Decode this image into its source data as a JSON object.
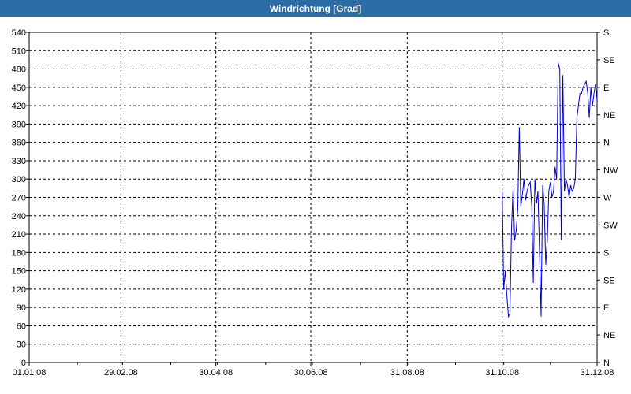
{
  "window": {
    "title": "Windrichtung [Grad]"
  },
  "chart_data": {
    "type": "line",
    "title": "Windrichtung [Grad]",
    "x_tick_labels": [
      "01.01.08",
      "29.02.08",
      "30.04.08",
      "30.06.08",
      "31.08.08",
      "31.10.08",
      "31.12.08"
    ],
    "y_ticks": [
      0,
      30,
      60,
      90,
      120,
      150,
      180,
      210,
      240,
      270,
      300,
      330,
      360,
      390,
      420,
      450,
      480,
      510,
      540
    ],
    "ylim": [
      0,
      540
    ],
    "right_axis_labels": [
      "N",
      "NE",
      "E",
      "SE",
      "S",
      "SW",
      "W",
      "NW",
      "N",
      "NE",
      "E",
      "SE",
      "S"
    ],
    "right_axis_step": 45,
    "x_start": "01.01.08",
    "x_end": "31.12.08",
    "grid": true,
    "line_color": "#0000cc",
    "series": [
      {
        "x": [
          "31.10.08",
          "01.11.08",
          "02.11.08",
          "03.11.08",
          "04.11.08",
          "05.11.08",
          "06.11.08",
          "07.11.08",
          "08.11.08",
          "09.11.08",
          "10.11.08",
          "11.11.08",
          "12.11.08",
          "13.11.08",
          "14.11.08",
          "15.11.08",
          "16.11.08",
          "17.11.08",
          "18.11.08",
          "19.11.08",
          "20.11.08",
          "21.11.08",
          "22.11.08",
          "23.11.08",
          "24.11.08",
          "25.11.08",
          "26.11.08",
          "27.11.08",
          "28.11.08",
          "29.11.08",
          "30.11.08",
          "01.12.08",
          "02.12.08",
          "03.12.08",
          "04.12.08",
          "05.12.08",
          "06.12.08",
          "07.12.08",
          "08.12.08",
          "09.12.08",
          "10.12.08",
          "11.12.08",
          "12.12.08",
          "13.12.08",
          "14.12.08",
          "15.12.08",
          "16.12.08",
          "17.12.08",
          "18.12.08",
          "19.12.08",
          "20.12.08",
          "21.12.08",
          "22.12.08",
          "23.12.08",
          "24.12.08",
          "25.12.08",
          "26.12.08",
          "27.12.08",
          "28.12.08",
          "29.12.08",
          "30.12.08",
          "31.12.08"
        ],
        "values": [
          280,
          120,
          150,
          110,
          75,
          80,
          220,
          285,
          200,
          215,
          250,
          385,
          255,
          275,
          300,
          265,
          280,
          290,
          295,
          255,
          130,
          300,
          260,
          280,
          180,
          75,
          290,
          260,
          160,
          200,
          280,
          295,
          270,
          280,
          320,
          300,
          490,
          480,
          200,
          470,
          280,
          300,
          290,
          270,
          290,
          280,
          285,
          300,
          400,
          420,
          440,
          440,
          450,
          455,
          460,
          440,
          400,
          450,
          420,
          440,
          455,
          430
        ]
      }
    ]
  }
}
